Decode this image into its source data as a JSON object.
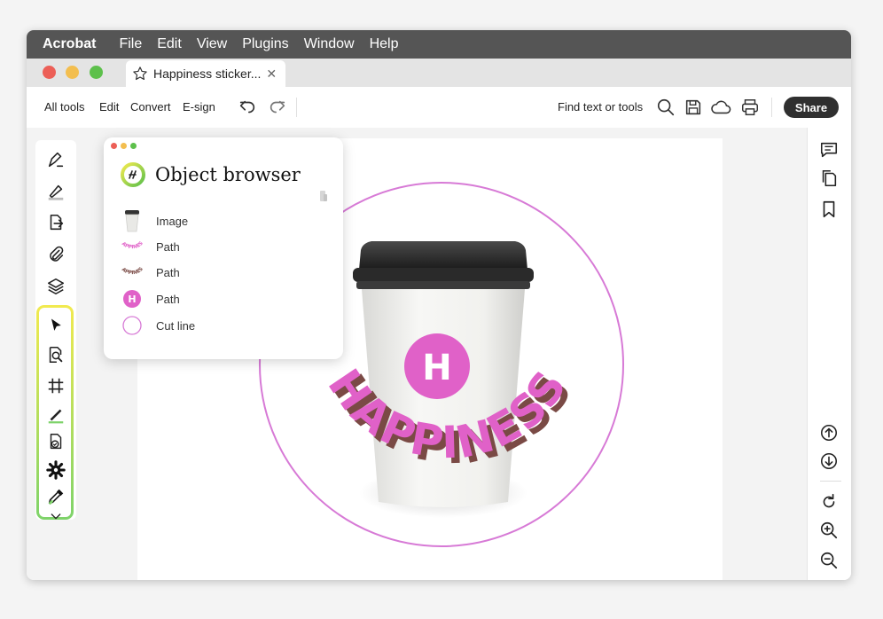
{
  "menubar": {
    "app_name": "Acrobat",
    "items": [
      "File",
      "Edit",
      "View",
      "Plugins",
      "Window",
      "Help"
    ]
  },
  "tab": {
    "title": "Happiness sticker...",
    "close_glyph": "✕"
  },
  "toolbar": {
    "all_tools": "All tools",
    "edit": "Edit",
    "convert": "Convert",
    "esign": "E-sign",
    "find": "Find text or tools",
    "share": "Share"
  },
  "object_browser": {
    "title": "Object browser",
    "items": [
      {
        "label": "Image",
        "thumb": "cup-thumbnail"
      },
      {
        "label": "Path",
        "thumb": "happiness-text-thumbnail"
      },
      {
        "label": "Path",
        "thumb": "happiness-shadow-thumbnail"
      },
      {
        "label": "Path",
        "thumb": "h-logo-thumbnail",
        "glyph": "H"
      },
      {
        "label": "Cut line",
        "thumb": "cut-circle-thumbnail"
      }
    ]
  },
  "sticker": {
    "arc_text": "HAPPINESS",
    "logo_letter": "H",
    "thumb_text": "HAPPINESS"
  },
  "colors": {
    "accent_pink": "#e061c8",
    "shadow_brown": "#7a4a45",
    "cut_line": "#d77ad6",
    "menubar": "#555555",
    "highlight_top": "#f2ea4f",
    "highlight_bottom": "#7ed36a"
  },
  "icons": {
    "left_tools": [
      "edit-pen-icon",
      "highlighter-icon",
      "export-icon",
      "attach-icon",
      "layers-icon",
      "select-arrow-icon",
      "zoom-page-icon",
      "crop-grid-icon",
      "line-draw-icon",
      "shapes-icon",
      "settings-gear-icon",
      "eyedropper-icon",
      "chevron-down-icon"
    ],
    "right_tools": [
      "comment-icon",
      "pages-icon",
      "bookmark-icon",
      "scroll-up-icon",
      "scroll-down-icon",
      "rotate-icon",
      "zoom-in-icon",
      "zoom-out-icon"
    ],
    "toolbar": [
      "undo-icon",
      "redo-icon",
      "search-icon",
      "save-icon",
      "cloud-icon",
      "print-icon"
    ]
  }
}
